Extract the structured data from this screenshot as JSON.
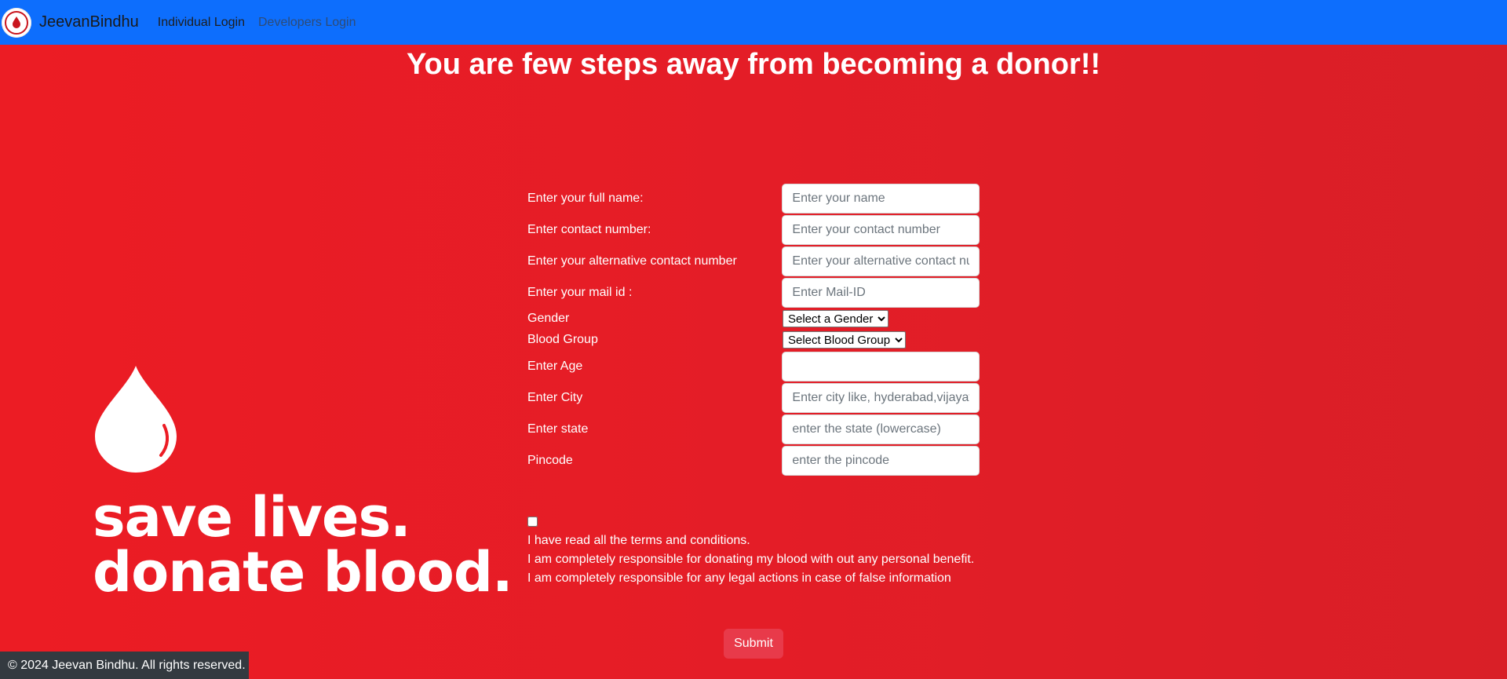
{
  "nav": {
    "brand": "JeevanBindhu",
    "links": [
      "Individual Login",
      "Developers Login"
    ],
    "logo_text": "Blood"
  },
  "headline": "You are few steps away from becoming a donor!!",
  "graphic": {
    "line1": "save lives.",
    "line2": "donate blood."
  },
  "form": {
    "name": {
      "label": "Enter your full name:",
      "placeholder": "Enter your name",
      "value": ""
    },
    "contact": {
      "label": "Enter contact number:",
      "placeholder": "Enter your contact number",
      "value": ""
    },
    "alt_contact": {
      "label": "Enter your alternative contact number",
      "placeholder": "Enter your alternative contact nu",
      "value": ""
    },
    "mail": {
      "label": "Enter your mail id :",
      "placeholder": "Enter Mail-ID",
      "value": ""
    },
    "gender": {
      "label": "Gender",
      "selected": "Select a Gender"
    },
    "blood_group": {
      "label": "Blood Group",
      "selected": "Select Blood Group"
    },
    "age": {
      "label": "Enter Age",
      "placeholder": "",
      "value": ""
    },
    "city": {
      "label": "Enter City",
      "placeholder": "Enter city like, hyderabad,vijayav",
      "value": ""
    },
    "state": {
      "label": "Enter state",
      "placeholder": "enter the state (lowercase)",
      "value": ""
    },
    "pincode": {
      "label": "Pincode",
      "placeholder": "enter the pincode",
      "value": ""
    }
  },
  "terms": {
    "checked": false,
    "lines": [
      "I have read all the terms and conditions.",
      "I am completely responsible for donating my blood with out any personal benefit.",
      "I am completely responsible for any legal actions in case of false information"
    ]
  },
  "submit_label": "Submit",
  "footer": "© 2024 Jeevan Bindhu. All rights reserved.",
  "colors": {
    "navbar": "#0d6efd",
    "background": "#ec1c24",
    "submit": "#e83a4a",
    "footer": "#343a40"
  }
}
